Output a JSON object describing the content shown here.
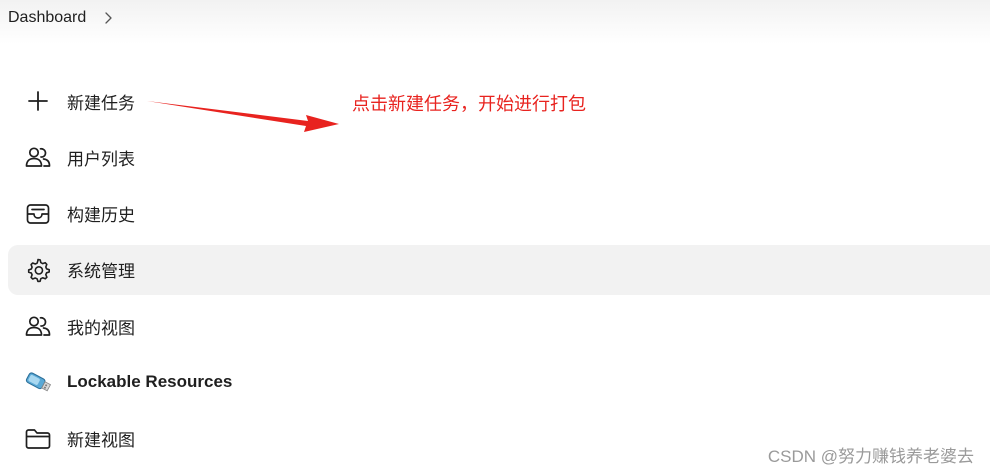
{
  "breadcrumb": {
    "root": "Dashboard",
    "separator_icon": "chevron-right-icon"
  },
  "tasks": [
    {
      "label": "新建任务",
      "icon": "plus-icon"
    },
    {
      "label": "用户列表",
      "icon": "users-icon"
    },
    {
      "label": "构建历史",
      "icon": "inbox-tray-icon"
    },
    {
      "label": "系统管理",
      "icon": "gear-icon",
      "active": true
    },
    {
      "label": "我的视图",
      "icon": "users-icon"
    },
    {
      "label": "Lockable Resources",
      "icon": "usb-drive-icon"
    },
    {
      "label": "新建视图",
      "icon": "folder-icon"
    }
  ],
  "annotation": {
    "text": "点击新建任务，开始进行打包",
    "color": "#e8231f"
  },
  "watermark": "CSDN @努力赚钱养老婆去"
}
